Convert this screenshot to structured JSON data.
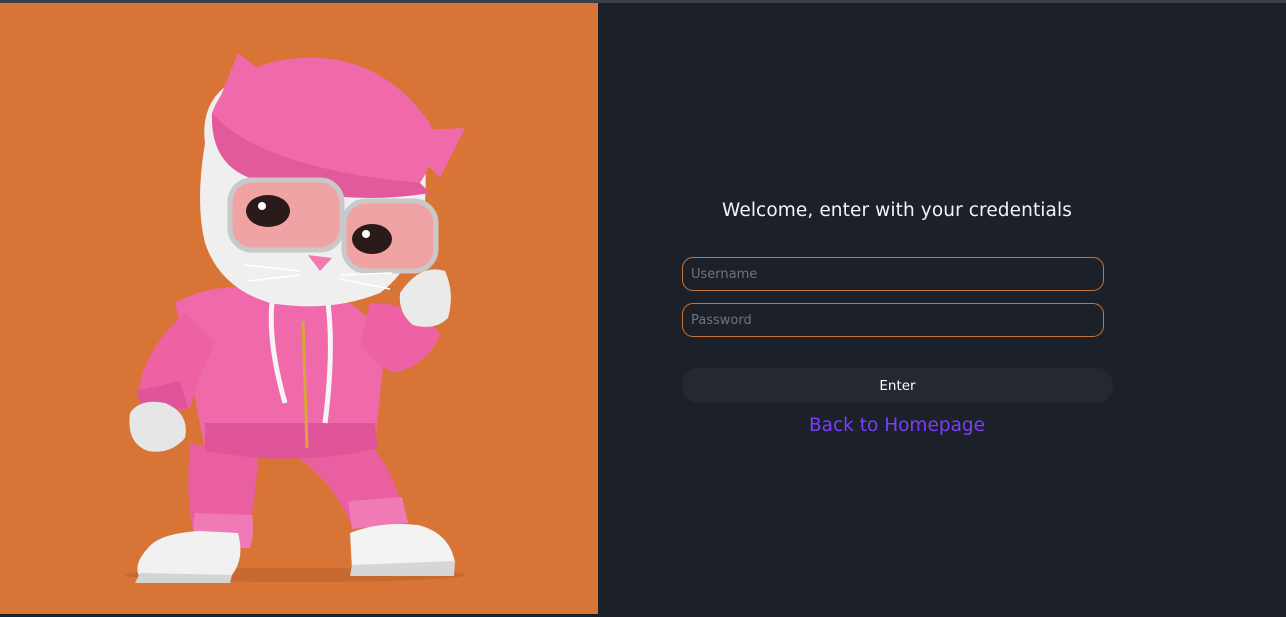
{
  "colors": {
    "page_background": "#1b2029",
    "illustration_background": "#d87436",
    "field_border": "#c7773b",
    "button_background": "#232831",
    "link_color": "#7a3cff",
    "title_color": "#f2f4f7"
  },
  "illustration": {
    "subject": "cat-mascot-in-pink-tracksuit-icon"
  },
  "login": {
    "title": "Welcome, enter with your credentials",
    "username": {
      "placeholder": "Username",
      "value": ""
    },
    "password": {
      "placeholder": "Password",
      "value": ""
    },
    "enter_label": "Enter",
    "back_link_label": "Back to Homepage"
  }
}
